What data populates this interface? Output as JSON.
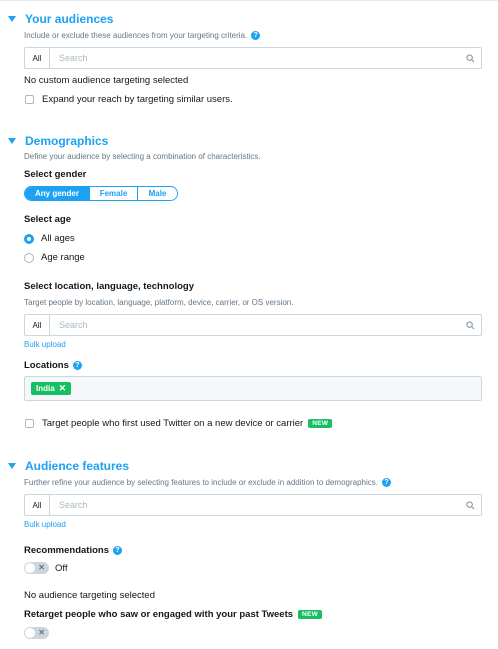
{
  "your_audiences": {
    "title": "Your audiences",
    "description": "Include or exclude these audiences from your targeting criteria.",
    "search": {
      "scope": "All",
      "placeholder": "Search"
    },
    "empty_text": "No custom audience targeting selected",
    "expand_label": "Expand your reach by targeting similar users."
  },
  "demographics": {
    "title": "Demographics",
    "description": "Define your audience by selecting a combination of characteristics.",
    "gender": {
      "label": "Select gender",
      "options": [
        "Any gender",
        "Female",
        "Male"
      ],
      "selected": "Any gender"
    },
    "age": {
      "label": "Select age",
      "options": [
        "All ages",
        "Age range"
      ],
      "selected": "All ages"
    },
    "location": {
      "label": "Select location, language, technology",
      "description": "Target people by location, language, platform, device, carrier, or OS version.",
      "search": {
        "scope": "All",
        "placeholder": "Search"
      },
      "bulk_upload": "Bulk upload"
    },
    "locations": {
      "label": "Locations",
      "tags": [
        "India"
      ]
    },
    "new_device": {
      "label": "Target people who first used Twitter on a new device or carrier",
      "badge": "NEW"
    }
  },
  "audience_features": {
    "title": "Audience features",
    "description": "Further refine your audience by selecting features to include or exclude in addition to demographics.",
    "search": {
      "scope": "All",
      "placeholder": "Search"
    },
    "bulk_upload": "Bulk upload",
    "recommendations": {
      "label": "Recommendations",
      "state": "Off"
    },
    "empty_text": "No audience targeting selected",
    "retarget": {
      "label": "Retarget people who saw or engaged with your past Tweets",
      "badge": "NEW"
    }
  },
  "colors": {
    "accent": "#1da1f2",
    "success": "#17bf63",
    "border": "#ccd6dd"
  }
}
